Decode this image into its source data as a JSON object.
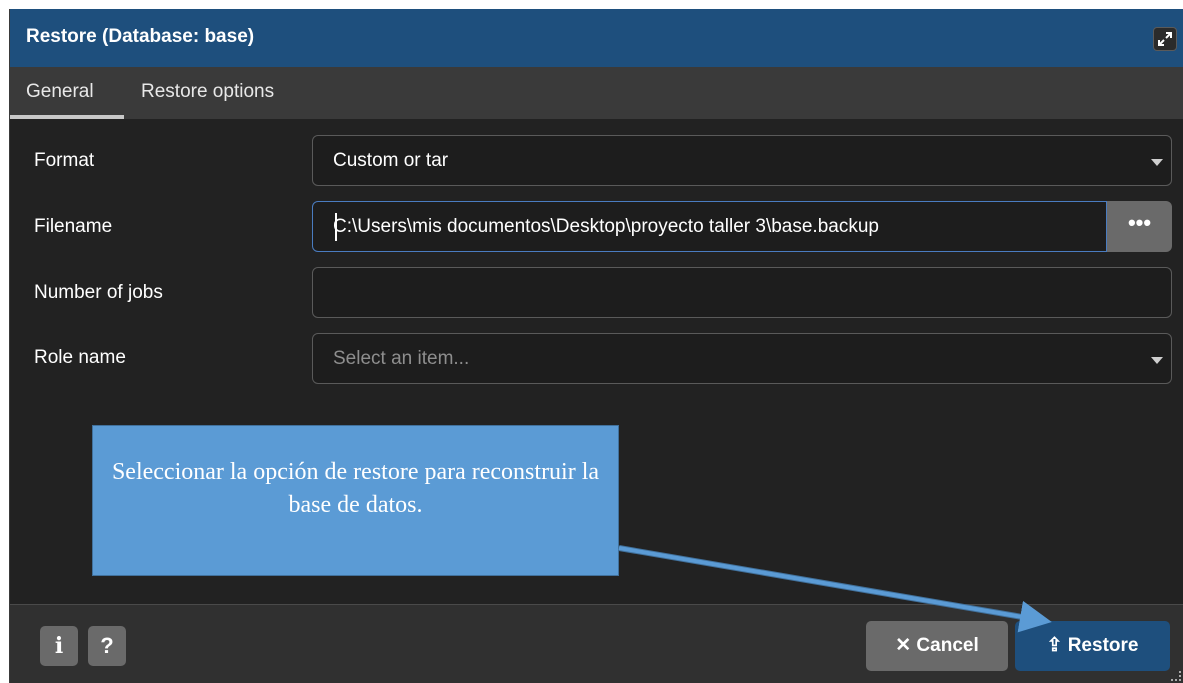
{
  "dialog": {
    "title": "Restore (Database: base)"
  },
  "tabs": [
    {
      "label": "General",
      "active": true
    },
    {
      "label": "Restore options",
      "active": false
    }
  ],
  "form": {
    "format_label": "Format",
    "format_value": "Custom or tar",
    "filename_label": "Filename",
    "filename_value": "C:\\Users\\mis documentos\\Desktop\\proyecto taller 3\\base.backup",
    "browse_label": "•••",
    "jobs_label": "Number of jobs",
    "jobs_value": "",
    "role_label": "Role name",
    "role_placeholder": "Select an item..."
  },
  "footer": {
    "info_label": "i",
    "help_label": "?",
    "cancel_label": "✕ Cancel",
    "restore_label": "⇪ Restore"
  },
  "callout": {
    "text": "Seleccionar la opción de restore para reconstruir la base de datos."
  },
  "colors": {
    "title_bar": "#1e4f7d",
    "callout": "#5b9bd5",
    "background": "#222222"
  },
  "icons": {
    "maximize": "expand-icon",
    "info": "info-icon",
    "help": "question-icon",
    "cancel": "close-icon",
    "restore": "upload-icon",
    "dropdown": "chevron-down-icon"
  }
}
